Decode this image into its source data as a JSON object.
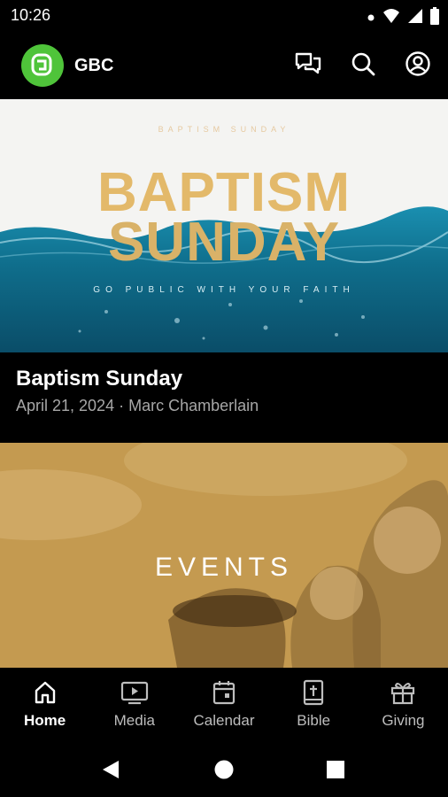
{
  "status_bar": {
    "time": "10:26"
  },
  "app_bar": {
    "title": "GBC",
    "actions": [
      "chat-icon",
      "search-icon",
      "account-icon"
    ]
  },
  "featured": {
    "banner": {
      "kicker": "BAPTISM SUNDAY",
      "title_line1": "BAPTISM",
      "title_line2": "SUNDAY",
      "tagline": "GO PUBLIC WITH YOUR FAITH"
    },
    "title": "Baptism Sunday",
    "meta": "April 21, 2024 · Marc Chamberlain"
  },
  "events": {
    "label": "EVENTS"
  },
  "tabs": [
    {
      "label": "Home",
      "icon": "home-icon",
      "active": true
    },
    {
      "label": "Media",
      "icon": "media-icon",
      "active": false
    },
    {
      "label": "Calendar",
      "icon": "calendar-icon",
      "active": false
    },
    {
      "label": "Bible",
      "icon": "bible-icon",
      "active": false
    },
    {
      "label": "Giving",
      "icon": "gift-icon",
      "active": false
    }
  ],
  "colors": {
    "brand": "#4fc43a",
    "banner_gold": "#e3b96a",
    "events_gold": "#c59c52",
    "water": "#0f6e8c"
  }
}
